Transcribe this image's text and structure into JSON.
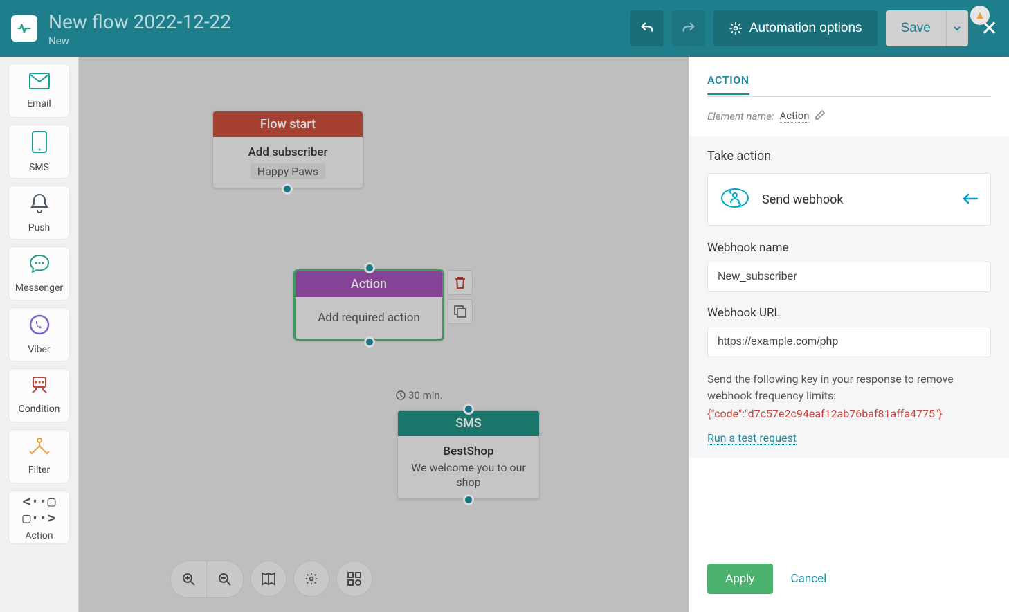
{
  "header": {
    "title": "New flow 2022-12-22",
    "subtitle": "New",
    "automation_options": "Automation options",
    "save": "Save"
  },
  "sidebar": {
    "items": [
      {
        "label": "Email"
      },
      {
        "label": "SMS"
      },
      {
        "label": "Push"
      },
      {
        "label": "Messenger"
      },
      {
        "label": "Viber"
      },
      {
        "label": "Condition"
      },
      {
        "label": "Filter"
      },
      {
        "label": "Action"
      }
    ]
  },
  "canvas": {
    "node1": {
      "head": "Flow start",
      "sub": "Add subscriber",
      "chip": "Happy Paws"
    },
    "node2": {
      "head": "Action",
      "body": "Add required action"
    },
    "node3": {
      "head": "SMS",
      "line1": "BestShop",
      "line2": "We welcome you to our shop"
    },
    "delay": "30 min."
  },
  "panel": {
    "tab": "ACTION",
    "element_name_label": "Element name:",
    "element_name_value": "Action",
    "take_action": "Take action",
    "action_type": "Send webhook",
    "webhook_name_label": "Webhook name",
    "webhook_name_value": "New_subscriber",
    "webhook_url_label": "Webhook URL",
    "webhook_url_value": "https://example.com/php",
    "hint": "Send the following key in your response to remove webhook frequency limits:",
    "code": "{\"code\":\"d7c57e2c94eaf12ab76baf81affa4775\"}",
    "test_link": "Run a test request",
    "apply": "Apply",
    "cancel": "Cancel"
  }
}
